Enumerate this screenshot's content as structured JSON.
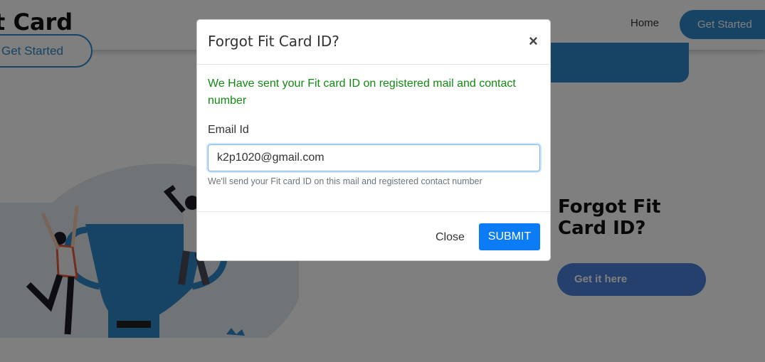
{
  "background": {
    "brand_text": "t Card",
    "nav": {
      "home_label": "Home",
      "cta_label": "Get Started"
    },
    "hero_button_label": "Get Started",
    "side_title": "Forgot Fit Card ID?",
    "side_button_label": "Get it here"
  },
  "modal": {
    "title": "Forgot Fit Card ID?",
    "close_glyph": "×",
    "success_message": "We Have sent your Fit card ID on registered mail and contact number",
    "email_label": "Email Id",
    "email_value": "k2p1020@gmail.com",
    "help_text": "We'll send your Fit card ID on this mail and registered contact number",
    "close_button_label": "Close",
    "submit_button_label": "SUBMIT"
  },
  "colors": {
    "accent_blue": "#2e86c8",
    "submit_blue": "#0b7cf5",
    "success_green": "#128a12"
  }
}
